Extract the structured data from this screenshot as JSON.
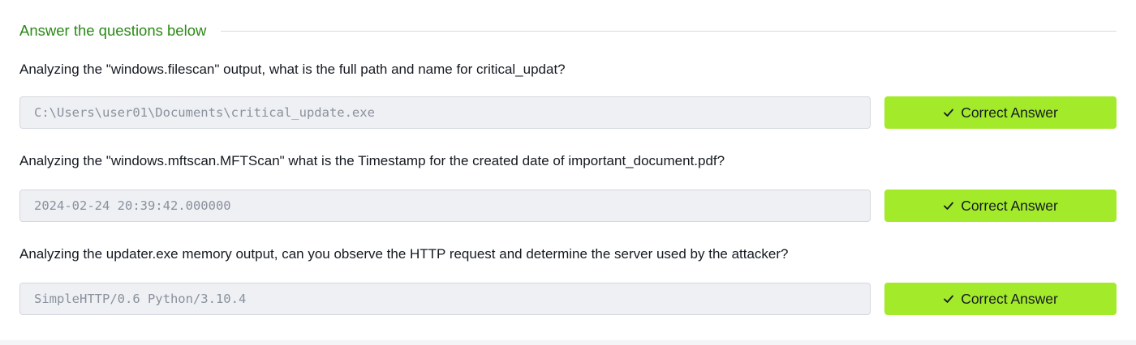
{
  "section": {
    "title": "Answer the questions below"
  },
  "questions": [
    {
      "text": "Analyzing the \"windows.filescan\" output, what is the full path and name for critical_updat?",
      "answer": "C:\\Users\\user01\\Documents\\critical_update.exe",
      "button_label": "Correct Answer",
      "button_icon": "check-icon"
    },
    {
      "text": "Analyzing the \"windows.mftscan.MFTScan\" what is the Timestamp for the created date of important_document.pdf?",
      "answer": "2024-02-24 20:39:42.000000",
      "button_label": "Correct Answer",
      "button_icon": "check-icon"
    },
    {
      "text": "Analyzing the updater.exe memory output, can you observe the HTTP request and determine the server used by the attacker?",
      "answer": "SimpleHTTP/0.6 Python/3.10.4",
      "button_label": "Correct Answer",
      "button_icon": "check-icon"
    }
  ],
  "colors": {
    "accent_green": "#2a8a16",
    "button_green": "#a3ea2a",
    "field_background": "#eef0f4"
  }
}
